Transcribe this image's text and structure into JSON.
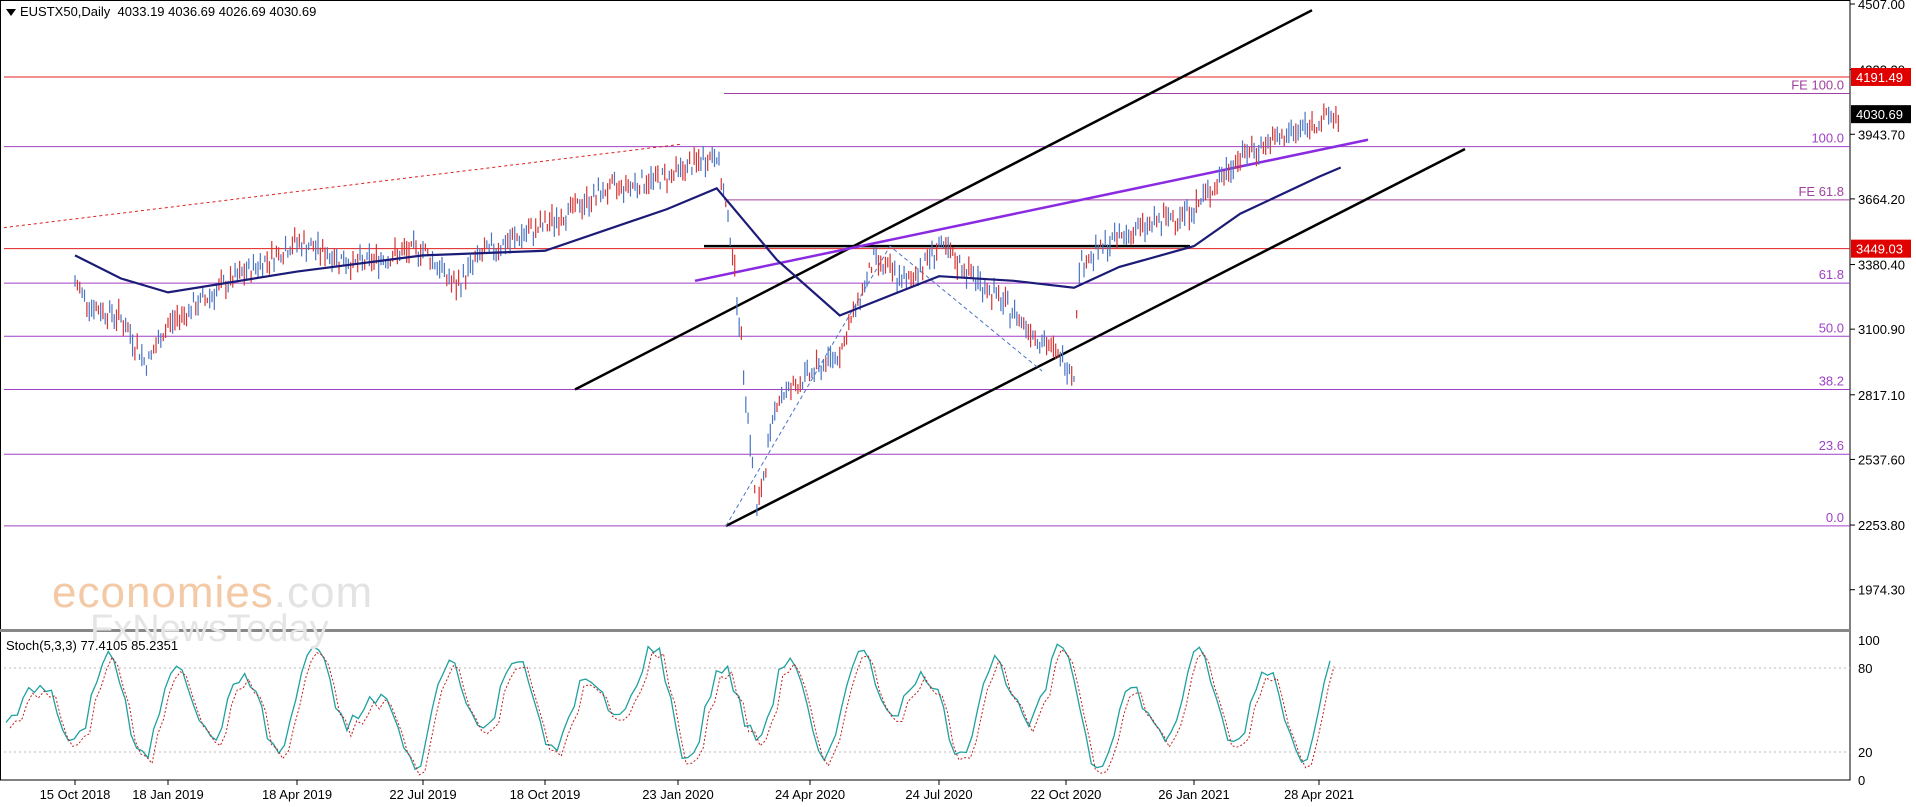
{
  "header": {
    "symbol": "EUSTX50,Daily",
    "ohlc": "4033.19 4036.69 4026.69 4030.69"
  },
  "oscillator": {
    "label": "Stoch(5,3,3)",
    "main": "77.4105",
    "signal": "85.2351",
    "levels": [
      "100",
      "80",
      "20",
      "0"
    ]
  },
  "watermark": {
    "brand": "economies",
    "suffix": ".com",
    "tagline": "FxNewsToday"
  },
  "colors": {
    "bar": "#d63333",
    "bar_alt": "#4a74c4",
    "ma": "#1c1c78",
    "fib": "#a040c8",
    "fe": "#a040a0",
    "hline": "#e02020",
    "channel": "#000000",
    "trend": "#8a2be2",
    "stoch_main": "#20a0a0",
    "stoch_signal": "#c02020"
  },
  "chart_data": {
    "type": "line",
    "title": "EUSTX50,Daily",
    "ylim": [
      1800,
      4507
    ],
    "y_ticks": [
      "4507.00",
      "4223.20",
      "3943.70",
      "3664.20",
      "3380.40",
      "3100.90",
      "2817.10",
      "2537.60",
      "2253.80",
      "1974.30"
    ],
    "x_ticks": [
      "15 Oct 2018",
      "18 Jan 2019",
      "18 Apr 2019",
      "22 Jul 2019",
      "18 Oct 2019",
      "23 Jan 2020",
      "24 Apr 2020",
      "24 Jul 2020",
      "22 Oct 2020",
      "26 Jan 2021",
      "28 Apr 2021"
    ],
    "price_labels": [
      {
        "value": 4191.49,
        "text": "4191.49"
      },
      {
        "value": 4030.69,
        "text": "4030.69"
      },
      {
        "value": 3449.03,
        "text": "3449.03"
      }
    ],
    "fib_levels": [
      {
        "value": 3890,
        "label": "100.0"
      },
      {
        "value": 3300,
        "label": "61.8"
      },
      {
        "value": 3070,
        "label": "50.0"
      },
      {
        "value": 2840,
        "label": "38.2"
      },
      {
        "value": 2560,
        "label": "23.6"
      },
      {
        "value": 2250,
        "label": "0.0"
      }
    ],
    "fe_levels": [
      {
        "value": 4120,
        "label": "FE 100.0"
      },
      {
        "value": 3660,
        "label": "FE 61.8"
      }
    ],
    "series": [
      {
        "name": "price",
        "x": [
          "15 Oct 2018",
          "1 Nov 2018",
          "1 Dec 2018",
          "27 Dec 2018",
          "18 Jan 2019",
          "1 Mar 2019",
          "18 Apr 2019",
          "1 Jun 2019",
          "22 Jul 2019",
          "15 Aug 2019",
          "1 Sep 2019",
          "18 Oct 2019",
          "1 Dec 2019",
          "15 Jan 2020",
          "19 Feb 2020",
          "1 Mar 2020",
          "18 Mar 2020",
          "1 Apr 2020",
          "15 May 2020",
          "8 Jun 2020",
          "1 Jul 2020",
          "24 Jul 2020",
          "1 Sep 2020",
          "28 Oct 2020",
          "1 Nov 2020",
          "1 Dec 2020",
          "26 Jan 2021",
          "1 Mar 2021",
          "28 Apr 2021",
          "14 May 2021"
        ],
        "values": [
          3300,
          3200,
          3150,
          2950,
          3120,
          3300,
          3480,
          3380,
          3450,
          3280,
          3420,
          3550,
          3700,
          3760,
          3860,
          3450,
          2300,
          2800,
          3000,
          3400,
          3300,
          3460,
          3250,
          2920,
          3380,
          3500,
          3620,
          3850,
          4000,
          4030
        ]
      },
      {
        "name": "ma",
        "x": [
          "15 Oct 2018",
          "1 Dec 2018",
          "18 Jan 2019",
          "18 Apr 2019",
          "22 Jul 2019",
          "18 Oct 2019",
          "15 Jan 2020",
          "19 Feb 2020",
          "1 Apr 2020",
          "15 May 2020",
          "24 Jul 2020",
          "15 Sep 2020",
          "28 Oct 2020",
          "1 Dec 2020",
          "26 Jan 2021",
          "1 Mar 2021",
          "28 Apr 2021",
          "14 May 2021"
        ],
        "values": [
          3420,
          3320,
          3260,
          3350,
          3420,
          3440,
          3620,
          3710,
          3400,
          3160,
          3330,
          3310,
          3280,
          3370,
          3460,
          3600,
          3760,
          3800
        ]
      },
      {
        "name": "stoch",
        "values": [
          40,
          70,
          25,
          90,
          15,
          85,
          30,
          75,
          20,
          95,
          40,
          60,
          10,
          85,
          35,
          90,
          20,
          70,
          45,
          95,
          15,
          80,
          30,
          88,
          12,
          92,
          50,
          75,
          20,
          85,
          40,
          95,
          10,
          65,
          30,
          90,
          25,
          80,
          15,
          95
        ]
      }
    ]
  }
}
